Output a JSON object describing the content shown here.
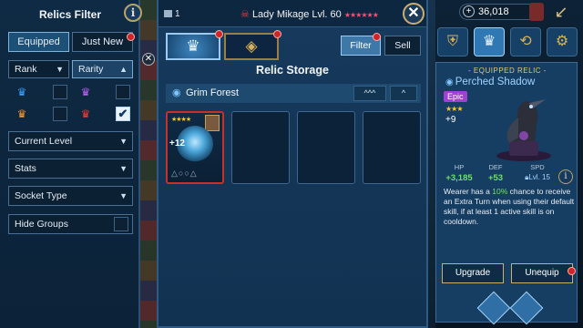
{
  "filter_panel": {
    "title": "Relics Filter",
    "info": "i",
    "tabs": [
      {
        "label": "Equipped",
        "active": true
      },
      {
        "label": "Just New",
        "active": false
      }
    ],
    "rank_label": "Rank",
    "rarity_label": "Rarity",
    "rarity_checked": "✔",
    "dropdowns": [
      "Current Level",
      "Stats",
      "Socket Type",
      "Hide Groups"
    ]
  },
  "storage": {
    "count": "1",
    "champion_name": "Lady Mikage Lvl. 60",
    "champion_stars": "★★★★★★",
    "close_label": "✕",
    "filter_label": "Filter",
    "sell_label": "Sell",
    "title": "Relic Storage",
    "group_name": "Grim Forest",
    "collapse_all": "^^^",
    "collapse": "^",
    "slot": {
      "stars": "★★★★",
      "level": "+12",
      "sockets": "△○○△"
    }
  },
  "right_panel": {
    "currency": "36,018",
    "plus": "+",
    "equipped_label": "- EQUIPPED RELIC -",
    "relic_name": "Perched Shadow",
    "rarity": "Epic",
    "stars": "★★★",
    "level": "+9",
    "stats": [
      {
        "label": "HP",
        "value": "+3,185"
      },
      {
        "label": "DEF",
        "value": "+53"
      },
      {
        "label": "SPD",
        "value": "Lvl. 15"
      }
    ],
    "desc_pre": "Wearer has a ",
    "desc_chance": "10%",
    "desc_post": " chance to receive an Extra Turn when using their default skill, if at least 1 active skill is on cooldown.",
    "upgrade_label": "Upgrade",
    "unequip_label": "Unequip",
    "info": "i"
  },
  "colors": {
    "panel": "#163a5d",
    "accent_gold": "#c9b072",
    "epic_purple": "#a040d6",
    "stat_green": "#6fe06a",
    "notify_red": "#d0242a"
  }
}
